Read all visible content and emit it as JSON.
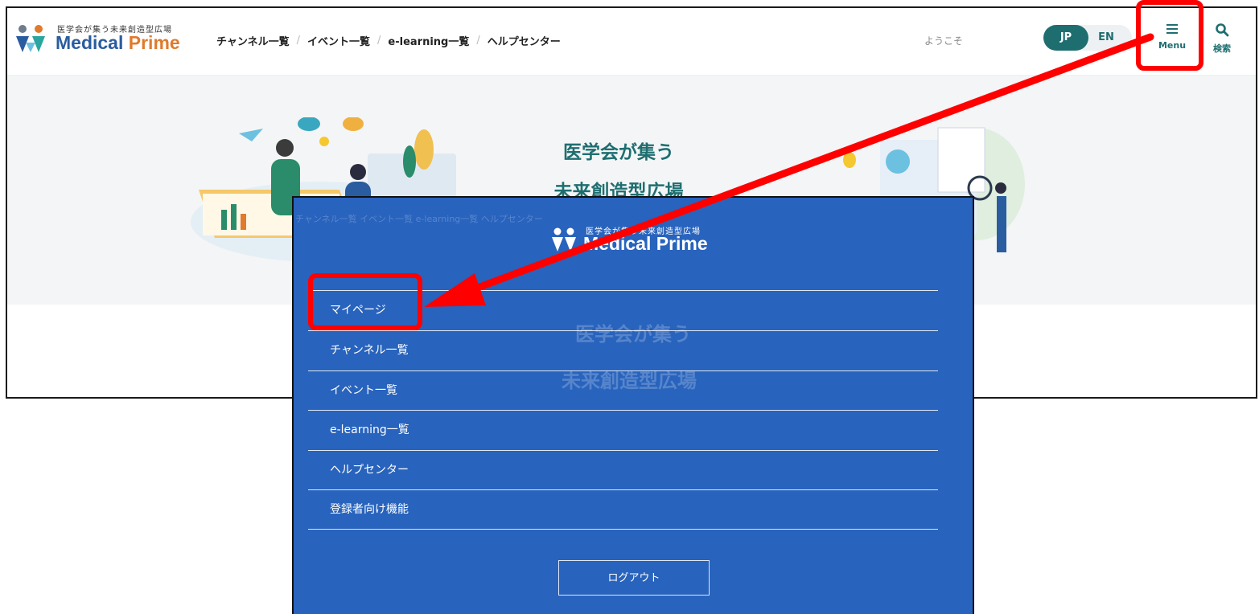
{
  "header": {
    "logo_tagline": "医学会が集う未来創造型広場",
    "logo_name_part1": "Medical",
    "logo_name_part2": "Prime",
    "nav": [
      "チャンネル一覧",
      "イベント一覧",
      "e-learning一覧",
      "ヘルプセンター"
    ],
    "welcome": "ようこそ",
    "lang_jp": "JP",
    "lang_en": "EN",
    "menu_label": "Menu",
    "search_label": "検索"
  },
  "hero": {
    "title_line1": "医学会が集う",
    "title_line2": "未来創造型広場"
  },
  "menu": {
    "logo_tagline": "医学会が集う未来創造型広場",
    "logo_name": "Medical Prime",
    "items": [
      "マイページ",
      "チャンネル一覧",
      "イベント一覧",
      "e-learning一覧",
      "ヘルプセンター",
      "登録者向け機能"
    ],
    "logout": "ログアウト",
    "ghost_nav": "チャンネル一覧   イベント一覧   e-learning一覧   ヘルプセンター",
    "ghost_line1": "医学会が集う",
    "ghost_line2": "未来創造型広場"
  },
  "colors": {
    "brand_teal": "#1e6e70",
    "brand_orange": "#e07a2c",
    "menu_blue": "#2863bd",
    "annotation_red": "#ff0000"
  }
}
